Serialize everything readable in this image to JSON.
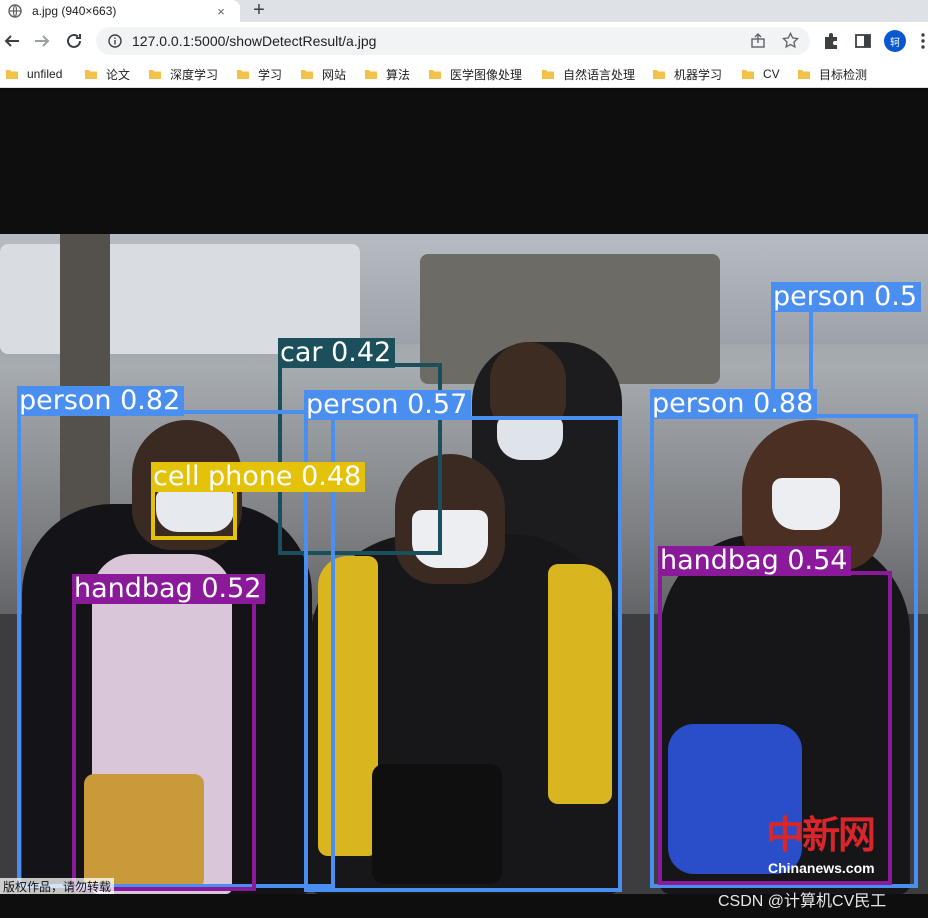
{
  "browser": {
    "tab": {
      "title": "a.jpg (940×663)",
      "close": "×"
    },
    "new_tab": "+",
    "url": "127.0.0.1:5000/showDetectResult/a.jpg",
    "profile_initial": "轲",
    "accent_color": "#1a73e8"
  },
  "bookmarks": [
    {
      "label": "unfiled"
    },
    {
      "label": "论文"
    },
    {
      "label": "深度学习"
    },
    {
      "label": "学习"
    },
    {
      "label": "网站"
    },
    {
      "label": "算法"
    },
    {
      "label": "医学图像处理"
    },
    {
      "label": "自然语言处理"
    },
    {
      "label": "机器学习"
    },
    {
      "label": "CV"
    },
    {
      "label": "目标检测"
    }
  ],
  "detections": [
    {
      "label": "person 0.5",
      "color": "#4a8ff0"
    },
    {
      "label": "car 0.42",
      "color": "#1c4f5c"
    },
    {
      "label": "person 0.82",
      "color": "#4a8ff0"
    },
    {
      "label": "person 0.57",
      "color": "#4a8ff0"
    },
    {
      "label": "person 0.88",
      "color": "#4a8ff0"
    },
    {
      "label": "cell phone 0.48",
      "color": "#e5c20a"
    },
    {
      "label": "handbag 0.52",
      "color": "#8b1a9a"
    },
    {
      "label": "handbag 0.54",
      "color": "#8b1a9a"
    }
  ],
  "watermark": {
    "seal": "中新网",
    "site": "Chinanews.com"
  },
  "photo_caption": "版权作品，请勿转载",
  "csdn_credit": "CSDN @计算机CV民工"
}
